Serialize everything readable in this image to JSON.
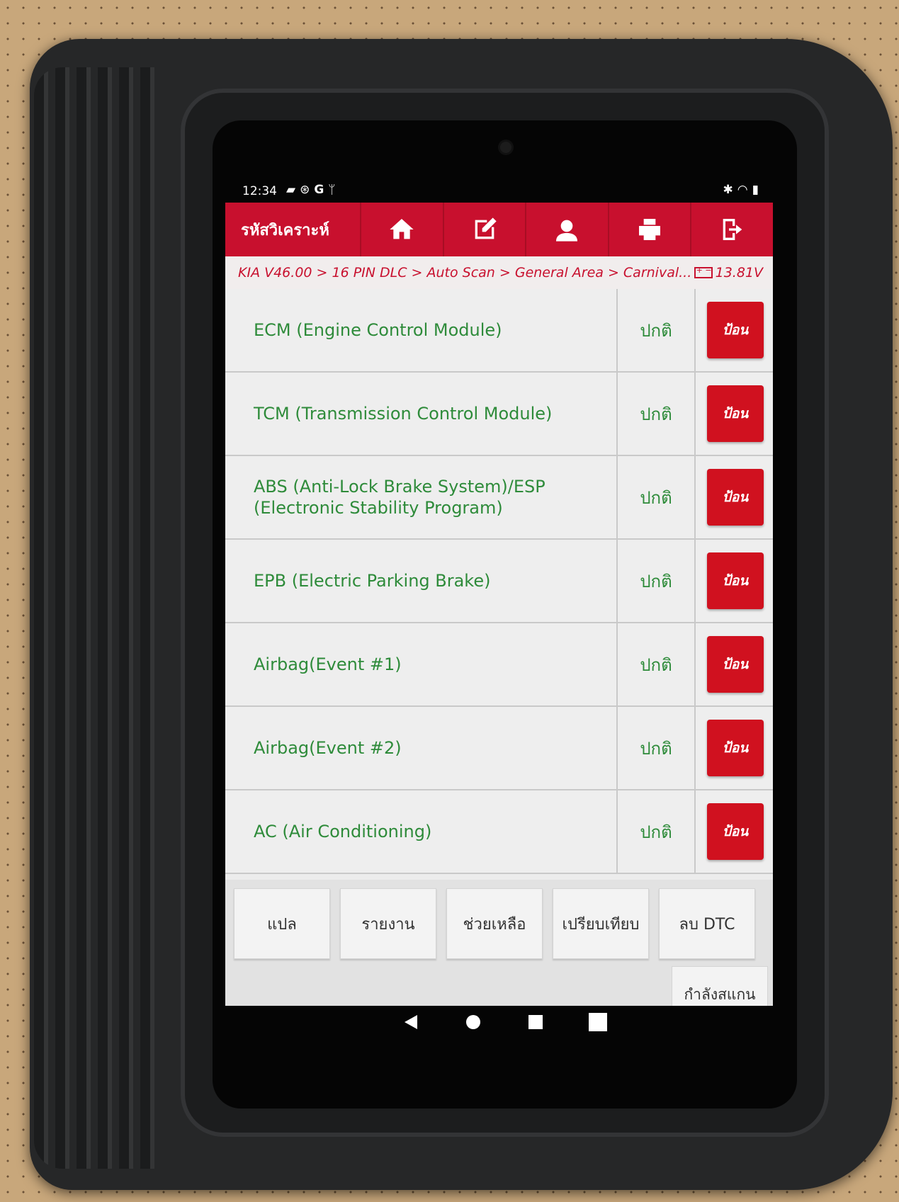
{
  "status_bar": {
    "time": "12:34",
    "left_icons": [
      "image-icon",
      "sync-icon",
      "google-icon",
      "usb-icon"
    ],
    "right_icons": [
      "bluetooth-icon",
      "wifi-icon",
      "battery-icon"
    ]
  },
  "header": {
    "title": "รหัสวิเคราะห์",
    "buttons": [
      "home-icon",
      "edit-icon",
      "support-icon",
      "print-icon",
      "exit-icon"
    ],
    "accent_color": "#c8102e"
  },
  "breadcrumb": {
    "path": "KIA V46.00 > 16 PIN DLC > Auto Scan > General Area > Carnival...",
    "voltage": "13.81V"
  },
  "systems": [
    {
      "name": "ECM (Engine Control Module)",
      "status": "ปกติ",
      "action": "ป้อน"
    },
    {
      "name": "TCM (Transmission Control Module)",
      "status": "ปกติ",
      "action": "ป้อน"
    },
    {
      "name": "ABS (Anti-Lock Brake System)/ESP (Electronic Stability Program)",
      "status": "ปกติ",
      "action": "ป้อน"
    },
    {
      "name": "EPB (Electric Parking Brake)",
      "status": "ปกติ",
      "action": "ป้อน"
    },
    {
      "name": "Airbag(Event #1)",
      "status": "ปกติ",
      "action": "ป้อน"
    },
    {
      "name": "Airbag(Event #2)",
      "status": "ปกติ",
      "action": "ป้อน"
    },
    {
      "name": "AC (Air Conditioning)",
      "status": "ปกติ",
      "action": "ป้อน"
    }
  ],
  "toolbar": {
    "translate": "แปล",
    "report": "รายงาน",
    "help": "ช่วยเหลือ",
    "compare": "เปรียบเทียบ",
    "clear_dtc": "ลบ DTC",
    "scanning": "กำลังสแกน"
  },
  "colors": {
    "status_text": "#2e8b3a",
    "enter_button": "#d0111f"
  }
}
